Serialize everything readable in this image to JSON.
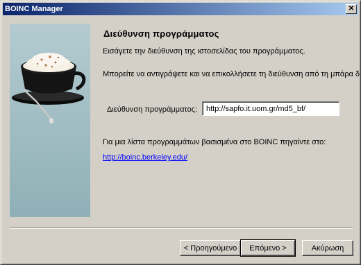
{
  "window": {
    "title": "BOINC Manager"
  },
  "page": {
    "heading": "Διεύθυνση προγράμματος",
    "description": "Εισάγετε την διεύθυνση της ιστοσελίδας του προγράμματος.",
    "hint": "Μπορείτε να αντιγράψετε και να επικολλήσετε τη διεύθυνση από τη μπάρα δ",
    "url_label": "Διεύθυνση προγράμματος:",
    "url_value": "http://sapfo.it.uom.gr/md5_bf/",
    "list_text": "Για μια λίστα προγραμμάτων βασισμένα στο BOINC πηγαίντε στο:",
    "list_link": "http://boinc.berkeley.edu/"
  },
  "buttons": {
    "back": "< Προηγούμενο",
    "next": "Επόμενο >",
    "cancel": "Ακύρωση"
  },
  "icons": {
    "close": "close-icon",
    "wizard_image": "coffee-cup-icon"
  }
}
